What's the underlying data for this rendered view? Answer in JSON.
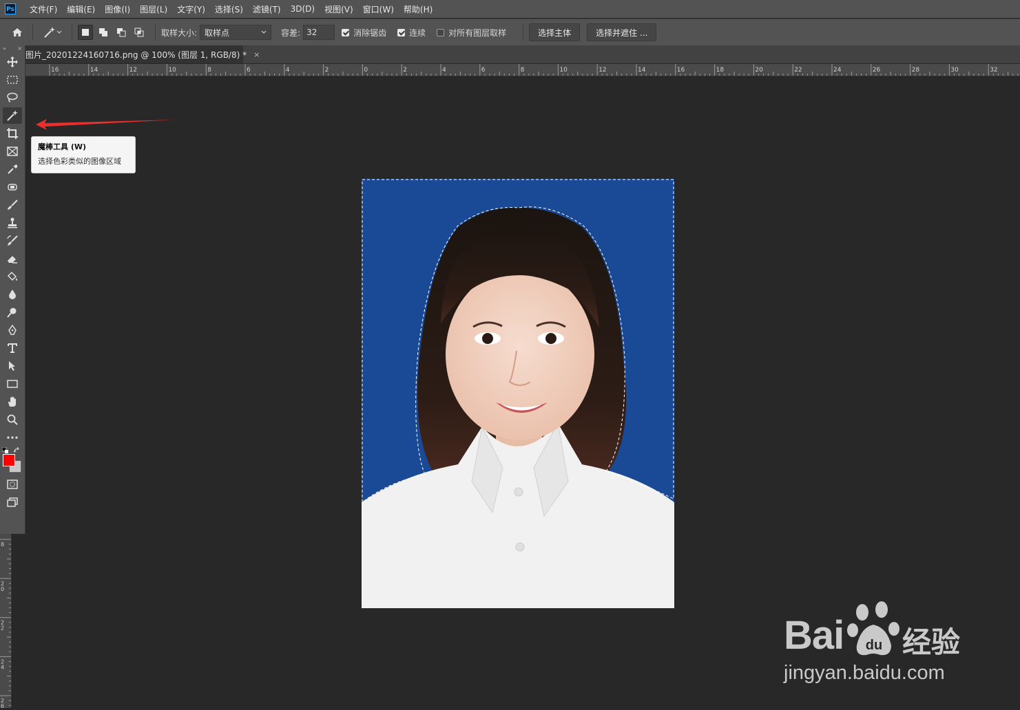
{
  "menu": {
    "logo": "Ps",
    "items": [
      "文件(F)",
      "编辑(E)",
      "图像(I)",
      "图层(L)",
      "文字(Y)",
      "选择(S)",
      "滤镜(T)",
      "3D(D)",
      "视图(V)",
      "窗口(W)",
      "帮助(H)"
    ]
  },
  "options": {
    "sample_size_label": "取样大小:",
    "sample_size_value": "取样点",
    "tolerance_label": "容差:",
    "tolerance_value": "32",
    "antialias_label": "消除锯齿",
    "antialias_checked": true,
    "contiguous_label": "连续",
    "contiguous_checked": true,
    "all_layers_label": "对所有图层取样",
    "all_layers_checked": false,
    "select_subject": "选择主体",
    "select_mask": "选择并遮住 ..."
  },
  "document": {
    "tab_title": "图片_20201224160716.png @ 100% (图层 1, RGB/8) *",
    "close_icon": "×"
  },
  "ruler": {
    "h_labels": [
      "16",
      "14",
      "12",
      "10",
      "8",
      "6",
      "4",
      "2",
      "0",
      "2",
      "4",
      "6",
      "8",
      "10",
      "12",
      "14",
      "16",
      "18",
      "20",
      "22",
      "24",
      "26",
      "28",
      "30",
      "32"
    ],
    "v_labels": [
      "8",
      "2\n0",
      "2\n2",
      "2\n4",
      "2\n6"
    ]
  },
  "tooltip": {
    "title": "魔棒工具 (W)",
    "description": "选择色彩类似的图像区域"
  },
  "colors": {
    "foreground": "#ff0000",
    "background": "#c8c8c8",
    "photo_bg": "#1a4a95",
    "arrow": "#e83030"
  },
  "watermark": {
    "brand": "Bai",
    "brand_suffix": "经验",
    "url": "jingyan.baidu.com"
  }
}
